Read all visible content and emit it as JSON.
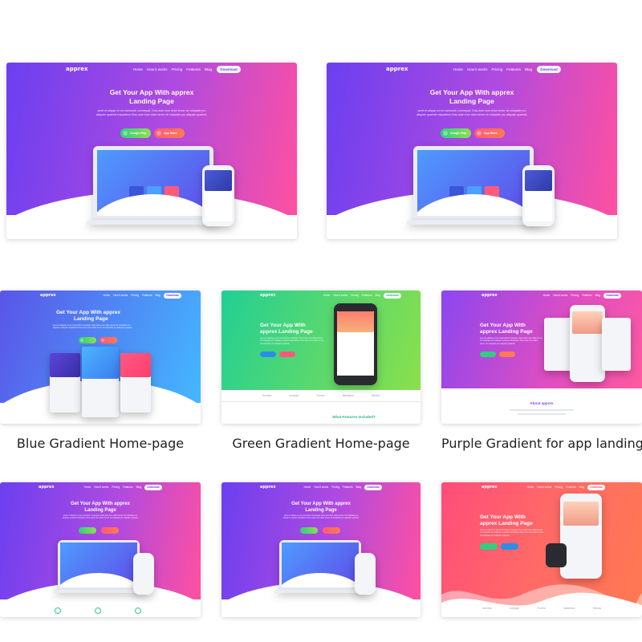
{
  "nav": {
    "logo": "apprex",
    "links": [
      "Home",
      "How it works",
      "Pricing",
      "Features",
      "Blog"
    ],
    "download": "Download"
  },
  "hero": {
    "title_line1": "Get Your App With apprex",
    "title_line2": "Landing Page",
    "subtitle": "amet et aliquip ex ea commodo consequat. Duis aute irure dolor tercer uli voluptate pro aliquam quaerat voluptatum.Duis aute irure dolor tercer uli voluptate pro aliquam quaerat.",
    "google_play": "Google Play",
    "app_store": "App Store"
  },
  "green": {
    "title_line1": "Get Your App With",
    "title_line2": "apprex Landing Page",
    "features_title": "What Features Included?",
    "partners": [
      "Amneks",
      "boxlogic",
      "Forrest",
      "Marketpro",
      "Mextra"
    ]
  },
  "purple": {
    "about_title": "About apprex"
  },
  "captions": {
    "blue": "Blue Gradient Home-page",
    "green": "Green Gradient Home-page",
    "purple": "Purple Gradient for app landing"
  },
  "colors": {
    "violet_start": "#7b3ff0",
    "violet_end": "#ff4e9b",
    "blue_start": "#5a55e8",
    "blue_end": "#44b8ff",
    "green_start": "#22cf95",
    "green_end": "#8be04a",
    "red_start": "#ff4d7a",
    "red_end": "#ff7a50"
  }
}
